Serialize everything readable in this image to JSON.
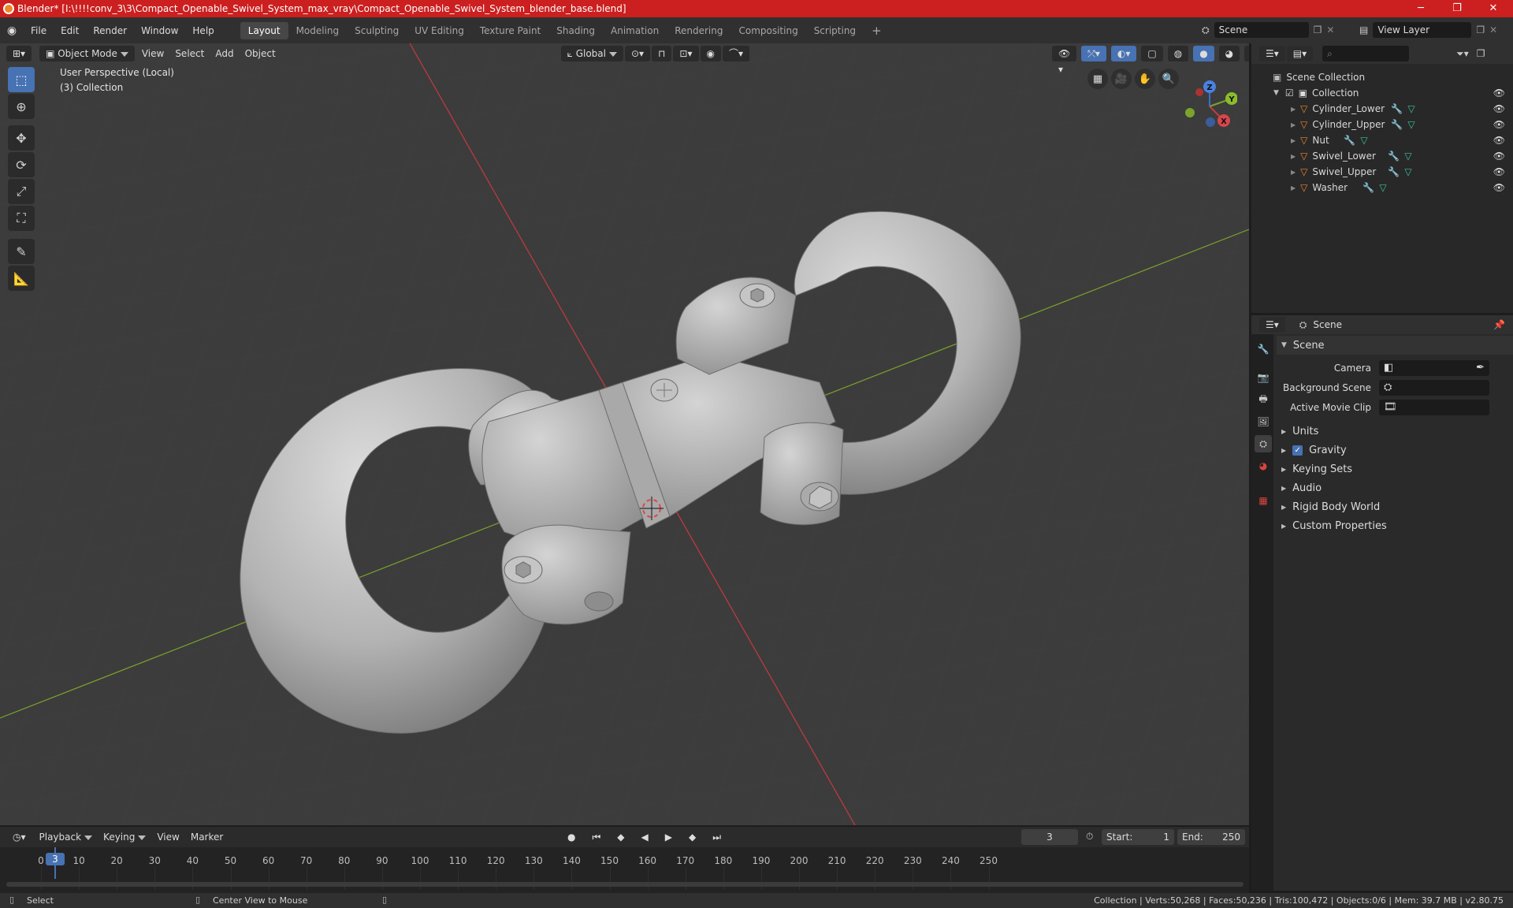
{
  "titlebar": {
    "title": "Blender* [I:\\!!!!conv_3\\3\\Compact_Openable_Swivel_System_max_vray\\Compact_Openable_Swivel_System_blender_base.blend]",
    "minimize": "─",
    "maximize": "❐",
    "close": "✕"
  },
  "menu": {
    "items": [
      "File",
      "Edit",
      "Render",
      "Window",
      "Help"
    ]
  },
  "workspaces": {
    "tabs": [
      "Layout",
      "Modeling",
      "Sculpting",
      "UV Editing",
      "Texture Paint",
      "Shading",
      "Animation",
      "Rendering",
      "Compositing",
      "Scripting"
    ],
    "add": "+"
  },
  "scene_selector": {
    "value": "Scene"
  },
  "viewlayer_selector": {
    "value": "View Layer"
  },
  "viewport": {
    "mode": "Object Mode",
    "menus": [
      "View",
      "Select",
      "Add",
      "Object"
    ],
    "transform_orientation": "Global",
    "overlay_text_1": "User Perspective (Local)",
    "overlay_text_2": "(3) Collection",
    "gizmo_axes": {
      "x": "X",
      "y": "Y",
      "z": "Z"
    },
    "colors": {
      "background": "#3c3c3c",
      "x_axis": "#c63a3f",
      "y_axis": "#7ba52a",
      "object": "#b9b9b9"
    }
  },
  "tools": [
    "select-box-icon",
    "cursor-icon",
    "move-icon",
    "rotate-icon",
    "scale-icon",
    "transform-icon",
    "annotate-icon",
    "measure-icon"
  ],
  "outliner": {
    "root": "Scene Collection",
    "collection": "Collection",
    "objects": [
      "Cylinder_Lower",
      "Cylinder_Upper",
      "Nut",
      "Swivel_Lower",
      "Swivel_Upper",
      "Washer"
    ]
  },
  "properties": {
    "context": "Scene",
    "section": "Scene",
    "fields": [
      {
        "label": "Camera",
        "value": ""
      },
      {
        "label": "Background Scene",
        "value": ""
      },
      {
        "label": "Active Movie Clip",
        "value": ""
      }
    ],
    "panels": [
      "Units",
      "Gravity",
      "Keying Sets",
      "Audio",
      "Rigid Body World",
      "Custom Properties"
    ],
    "gravity_checked": true
  },
  "timeline": {
    "menus": [
      "Playback",
      "Keying",
      "View",
      "Marker"
    ],
    "current_frame": "3",
    "start_label": "Start:",
    "start": "1",
    "end_label": "End:",
    "end": "250",
    "ruler": [
      "0",
      "10",
      "20",
      "30",
      "40",
      "50",
      "60",
      "70",
      "80",
      "90",
      "100",
      "110",
      "120",
      "130",
      "140",
      "150",
      "160",
      "170",
      "180",
      "190",
      "200",
      "210",
      "220",
      "230",
      "240",
      "250"
    ]
  },
  "statusbar": {
    "select": "Select",
    "center": "Center View to Mouse",
    "stats": "Collection | Verts:50,268 | Faces:50,236 | Tris:100,472 | Objects:0/6 | Mem: 39.7 MB | v2.80.75"
  }
}
